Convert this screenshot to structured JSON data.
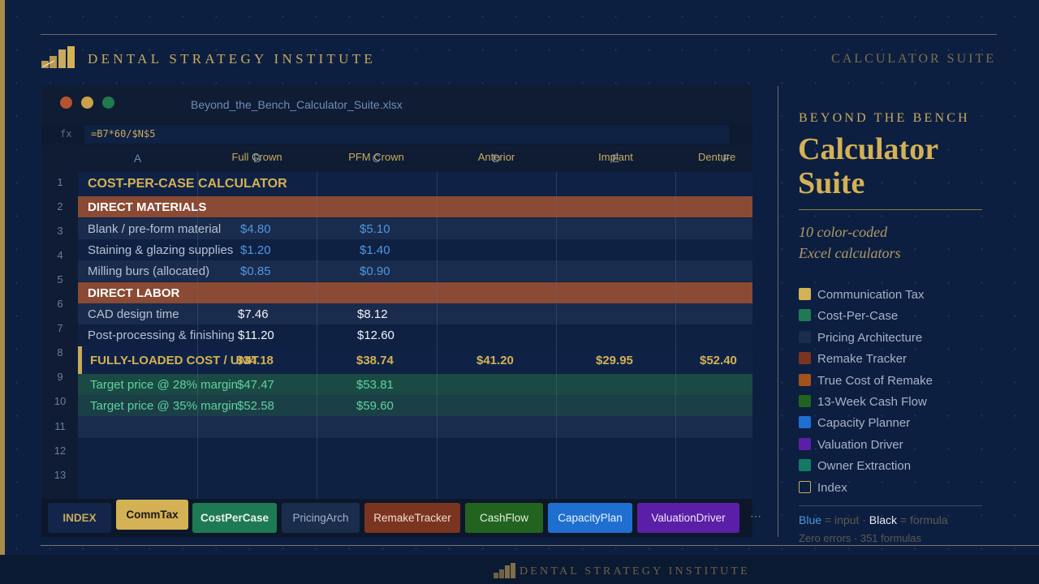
{
  "brand": "DENTAL STRATEGY INSTITUTE",
  "header_right": "CALCULATOR SUITE",
  "window": {
    "filename": "Beyond_the_Bench_Calculator_Suite.xlsx",
    "fx_label": "fx",
    "formula": "=B7*60/$N$5"
  },
  "columns": [
    {
      "letter": "A",
      "label": ""
    },
    {
      "letter": "B",
      "label": "Full Crown"
    },
    {
      "letter": "C",
      "label": "PFM Crown"
    },
    {
      "letter": "D",
      "label": "Anterior"
    },
    {
      "letter": "E",
      "label": "Implant"
    },
    {
      "letter": "F",
      "label": "Denture"
    }
  ],
  "row_numbers": [
    "1",
    "2",
    "3",
    "4",
    "5",
    "6",
    "7",
    "8",
    "9",
    "10",
    "11",
    "12",
    "13"
  ],
  "rows": {
    "title": "COST-PER-CASE CALCULATOR",
    "materials": "DIRECT MATERIALS",
    "blank": {
      "label": "Blank / pre-form material",
      "b": "$4.80",
      "c": "$5.10"
    },
    "staining": {
      "label": "Staining & glazing supplies",
      "b": "$1.20",
      "c": "$1.40"
    },
    "burs": {
      "label": "Milling burs (allocated)",
      "b": "$0.85",
      "c": "$0.90"
    },
    "labor": "DIRECT LABOR",
    "cad": {
      "label": "CAD design time",
      "b": "$7.46",
      "c": "$8.12"
    },
    "post": {
      "label": "Post-processing & finishing",
      "b": "$11.20",
      "c": "$12.60"
    },
    "total": {
      "label": "FULLY-LOADED COST / UNIT",
      "b": "$34.18",
      "c": "$38.74",
      "d": "$41.20",
      "e": "$29.95",
      "f": "$52.40"
    },
    "t28": {
      "label": "Target price @ 28% margin",
      "b": "$47.47",
      "c": "$53.81"
    },
    "t35": {
      "label": "Target price @ 35% margin",
      "b": "$52.58",
      "c": "$59.60"
    }
  },
  "tabs": [
    {
      "label": "INDEX",
      "bg": "#13254a",
      "fg": "#c9aa5e"
    },
    {
      "label": "CommTax",
      "bg": "#d4b155",
      "fg": "#1a1a1a"
    },
    {
      "label": "CostPerCase",
      "bg": "#1e7a52",
      "fg": "#e8f1ea"
    },
    {
      "label": "PricingArch",
      "bg": "#1b2d4d",
      "fg": "#9fb0c9"
    },
    {
      "label": "RemakeTracker",
      "bg": "#7b3420",
      "fg": "#f0ddd3"
    },
    {
      "label": "CashFlow",
      "bg": "#22631f",
      "fg": "#e3f0df"
    },
    {
      "label": "CapacityPlan",
      "bg": "#1f6fd0",
      "fg": "#eaf1fb"
    },
    {
      "label": "ValuationDriver",
      "bg": "#5a1fa6",
      "fg": "#eee6fa"
    }
  ],
  "tabs_more": "⋯",
  "panel": {
    "kicker": "BEYOND THE BENCH",
    "title_line1": "Calculator",
    "title_line2": "Suite",
    "sub_line1": "10 color-coded",
    "sub_line2": "Excel calculators",
    "legend": [
      {
        "label": "Communication Tax",
        "color": "#d4b155"
      },
      {
        "label": "Cost-Per-Case",
        "color": "#1e7a52"
      },
      {
        "label": "Pricing Architecture",
        "color": "#1b2d4d"
      },
      {
        "label": "Remake Tracker",
        "color": "#7b3420"
      },
      {
        "label": "True Cost of Remake",
        "color": "#a4521c"
      },
      {
        "label": "13-Week Cash Flow",
        "color": "#22631f"
      },
      {
        "label": "Capacity Planner",
        "color": "#1f6fd0"
      },
      {
        "label": "Valuation Driver",
        "color": "#5a1fa6"
      },
      {
        "label": "Owner Extraction",
        "color": "#137a66"
      },
      {
        "label": "Index",
        "color": "outline"
      }
    ],
    "note_blue": "Blue",
    "note_input": " = input · ",
    "note_black": "Black",
    "note_formula": " = formula",
    "stats": "Zero errors · 351 formulas"
  },
  "footer_brand": "DENTAL STRATEGY INSTITUTE"
}
